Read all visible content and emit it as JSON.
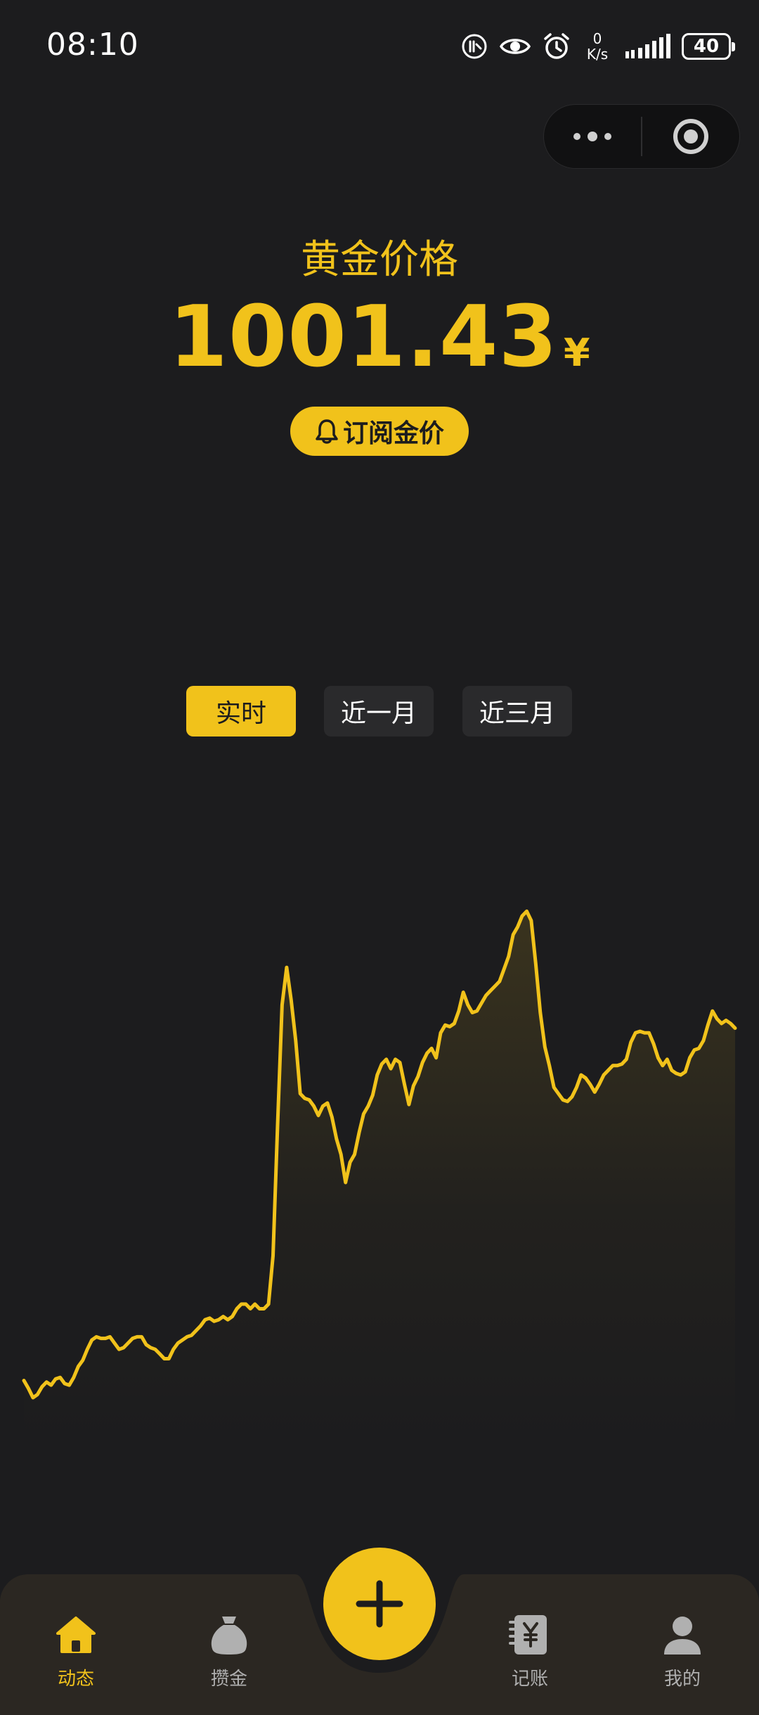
{
  "status_bar": {
    "time": "08:10",
    "net_speed_value": "0",
    "net_speed_unit": "K/s",
    "battery_level": "40",
    "icons": [
      "nfc-icon",
      "eye-icon",
      "alarm-icon",
      "signal-icon",
      "battery-icon"
    ]
  },
  "capsule": {
    "icons": [
      "more-dots-icon",
      "close-circle-icon"
    ]
  },
  "header": {
    "title": "黄金价格",
    "price": "1001.43",
    "currency": "¥"
  },
  "subscribe": {
    "label": "订阅金价",
    "icon": "bell-icon"
  },
  "tabs": [
    {
      "label": "实时",
      "active": true
    },
    {
      "label": "近一月",
      "active": false
    },
    {
      "label": "近三月",
      "active": false
    }
  ],
  "chart_data": {
    "type": "area",
    "x": [],
    "values": [
      962.4,
      961.9,
      961.3,
      961.5,
      962.0,
      962.3,
      962.1,
      962.5,
      962.6,
      962.2,
      962.1,
      962.6,
      963.3,
      963.7,
      964.4,
      965.0,
      965.2,
      965.1,
      965.1,
      965.2,
      964.8,
      964.4,
      964.5,
      964.8,
      965.1,
      965.2,
      965.2,
      964.7,
      964.5,
      964.4,
      964.1,
      963.8,
      963.8,
      964.4,
      964.8,
      965.0,
      965.2,
      965.3,
      965.6,
      965.9,
      966.3,
      966.4,
      966.2,
      966.3,
      966.5,
      966.3,
      966.5,
      967.0,
      967.3,
      967.3,
      967.0,
      967.3,
      967.0,
      967.0,
      967.3,
      970.4,
      978.8,
      986.5,
      988.9,
      986.8,
      984.2,
      980.8,
      980.5,
      980.4,
      980.0,
      979.4,
      980.0,
      980.2,
      979.3,
      977.9,
      976.9,
      975.1,
      976.4,
      976.9,
      978.3,
      979.5,
      980.0,
      980.7,
      982.0,
      982.7,
      983.0,
      982.4,
      983.0,
      982.8,
      981.4,
      980.1,
      981.3,
      981.9,
      982.8,
      983.4,
      983.7,
      983.1,
      984.7,
      985.2,
      985.1,
      985.3,
      986.1,
      987.3,
      986.5,
      986.0,
      986.1,
      986.6,
      987.1,
      987.4,
      987.7,
      988.0,
      988.8,
      989.6,
      991.0,
      991.5,
      992.2,
      992.5,
      991.9,
      989.1,
      986.0,
      983.8,
      982.6,
      981.2,
      980.8,
      980.4,
      980.3,
      980.6,
      981.2,
      982.0,
      981.8,
      981.4,
      980.9,
      981.4,
      982.0,
      982.3,
      982.6,
      982.6,
      982.7,
      983.0,
      984.1,
      984.7,
      984.8,
      984.7,
      984.7,
      984.0,
      983.1,
      982.6,
      983.0,
      982.3,
      982.1,
      982.0,
      982.2,
      983.1,
      983.6,
      983.7,
      984.2,
      985.2,
      986.1,
      985.6,
      985.3,
      985.5,
      985.3,
      985.0
    ],
    "title": "",
    "xlabel": "",
    "ylabel": "",
    "ylim": [
      958,
      995
    ],
    "grid": false,
    "line_color": "#f1c21b"
  },
  "bottom_nav": {
    "items": [
      {
        "label": "动态",
        "icon": "home-icon",
        "active": true
      },
      {
        "label": "攒金",
        "icon": "money-bag-icon",
        "active": false
      },
      {
        "label": "记账",
        "icon": "ledger-icon",
        "active": false
      },
      {
        "label": "我的",
        "icon": "user-icon",
        "active": false
      }
    ],
    "center_button_icon": "plus-icon"
  },
  "colors": {
    "accent": "#f1c21b",
    "background": "#1c1c1e",
    "tab_inactive": "#2a2a2c",
    "nav_background": "#2b2722"
  }
}
